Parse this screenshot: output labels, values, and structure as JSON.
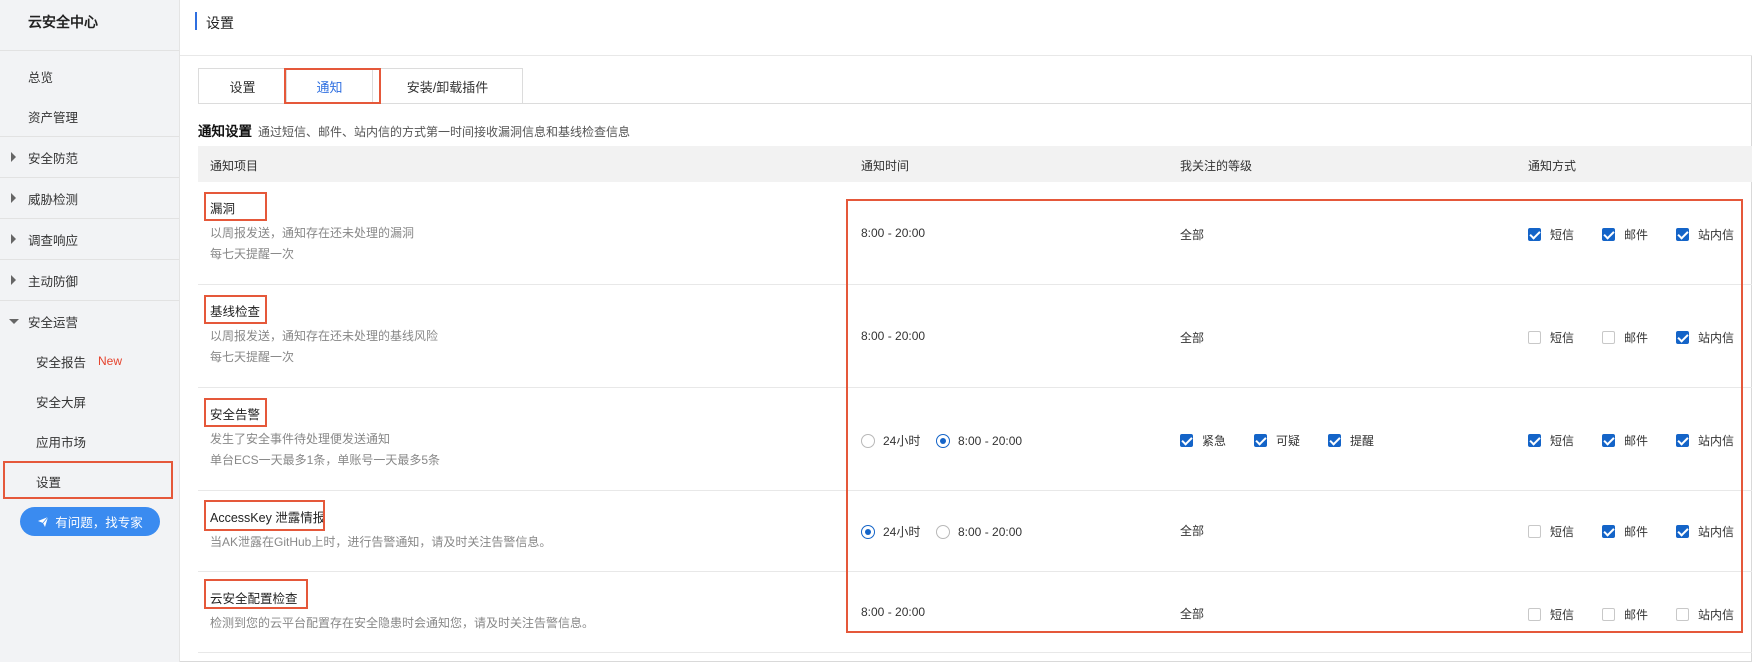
{
  "sidebar": {
    "title": "云安全中心",
    "items": [
      {
        "label": "总览"
      },
      {
        "label": "资产管理"
      },
      {
        "label": "安全防范"
      },
      {
        "label": "威胁检测"
      },
      {
        "label": "调查响应"
      },
      {
        "label": "主动防御"
      },
      {
        "label": "安全运营"
      },
      {
        "label": "安全报告",
        "badge": "New"
      },
      {
        "label": "安全大屏"
      },
      {
        "label": "应用市场"
      },
      {
        "label": "设置"
      }
    ],
    "help_button": "有问题，找专家"
  },
  "header": {
    "title": "设置"
  },
  "tabs": [
    {
      "label": "设置"
    },
    {
      "label": "通知"
    },
    {
      "label": "安装/卸载插件"
    }
  ],
  "section": {
    "title": "通知设置",
    "desc": "通过短信、邮件、站内信的方式第一时间接收漏洞信息和基线检查信息"
  },
  "table": {
    "headers": [
      "通知项目",
      "通知时间",
      "我关注的等级",
      "通知方式"
    ],
    "rows": [
      {
        "name": "漏洞",
        "desc1": "以周报发送，通知存在还未处理的漏洞",
        "desc2": "每七天提醒一次",
        "time": "8:00 - 20:00",
        "level": "全部",
        "methods": {
          "sms": "短信",
          "email": "邮件",
          "inbox": "站内信"
        }
      },
      {
        "name": "基线检查",
        "desc1": "以周报发送，通知存在还未处理的基线风险",
        "desc2": "每七天提醒一次",
        "time": "8:00 - 20:00",
        "level": "全部",
        "methods": {
          "sms": "短信",
          "email": "邮件",
          "inbox": "站内信"
        }
      },
      {
        "name": "安全告警",
        "desc1": "发生了安全事件待处理便发送通知",
        "desc2": "单台ECS一天最多1条，单账号一天最多5条",
        "time_opt1": "24小时",
        "time_opt2": "8:00 - 20:00",
        "level_opts": {
          "urgent": "紧急",
          "suspicious": "可疑",
          "reminder": "提醒"
        },
        "methods": {
          "sms": "短信",
          "email": "邮件",
          "inbox": "站内信"
        }
      },
      {
        "name": "AccessKey 泄露情报",
        "desc1": "当AK泄露在GitHub上时，进行告警通知，请及时关注告警信息。",
        "time_opt1": "24小时",
        "time_opt2": "8:00 - 20:00",
        "level": "全部",
        "methods": {
          "sms": "短信",
          "email": "邮件",
          "inbox": "站内信"
        }
      },
      {
        "name": "云安全配置检查",
        "desc1": "检测到您的云平台配置存在安全隐患时会通知您，请及时关注告警信息。",
        "time": "8:00 - 20:00",
        "level": "全部",
        "methods": {
          "sms": "短信",
          "email": "邮件",
          "inbox": "站内信"
        }
      }
    ]
  },
  "colors": {
    "accent": "#1464c8",
    "highlight": "#e5583a",
    "help_button": "#3a8bf0",
    "badge": "#e5432d"
  }
}
